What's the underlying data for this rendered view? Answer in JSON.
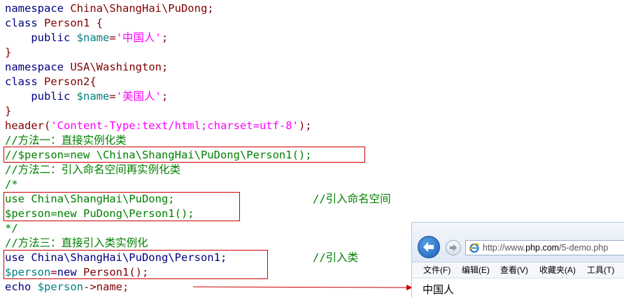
{
  "code": {
    "line1": {
      "kw": "namespace",
      "rest": " China\\ShangHai\\PuDong;"
    },
    "line2": {
      "kw": "class",
      "rest": " Person1 {"
    },
    "line3": {
      "indent": "    ",
      "kw": "public",
      "sp": " ",
      "var": "$name",
      "eq": "=",
      "str": "'中国人'",
      "end": ";"
    },
    "line4": {
      "text": "}"
    },
    "line5": {
      "kw": "namespace",
      "rest": " USA\\Washington;"
    },
    "line6": {
      "kw": "class",
      "rest": " Person2{"
    },
    "line7": {
      "indent": "    ",
      "kw": "public",
      "sp": " ",
      "var": "$name",
      "eq": "=",
      "str": "'美国人'",
      "end": ";"
    },
    "line8": {
      "text": "}"
    },
    "line9": {
      "fn": "header(",
      "str": "'Content-Type:text/html;charset=utf-8'",
      "end": ");"
    },
    "line10": {
      "text": "//方法一：直接实例化类"
    },
    "line11": {
      "text": "//$person=new \\China\\ShangHai\\PuDong\\Person1();"
    },
    "line12": {
      "text": "//方法二：引入命名空间再实例化类"
    },
    "line13": {
      "text": "/*"
    },
    "line14": {
      "code": "use China\\ShangHai\\PuDong;",
      "comment": "//引入命名空间"
    },
    "line15": {
      "text": "$person=new PuDong\\Person1();"
    },
    "line16": {
      "text": "*/"
    },
    "line17": {
      "text": "//方法三：直接引入类实例化"
    },
    "line18": {
      "code": "use China\\ShangHai\\PuDong\\Person1;",
      "comment": "//引入类"
    },
    "line19": {
      "var": "$person",
      "eq": "=",
      "kw": "new",
      "rest": " Person1();"
    },
    "line20": {
      "kw": "echo",
      "sp": " ",
      "var": "$person",
      "rest": "->name;"
    }
  },
  "browser": {
    "url_prefix": "http://www.",
    "url_domain": "php.com",
    "url_suffix": "/5-demo.php",
    "menu": [
      "文件(F)",
      "编辑(E)",
      "查看(V)",
      "收藏夹(A)",
      "工具(T)"
    ],
    "page_output": "中国人",
    "icons": {
      "back": "back-arrow-icon",
      "forward": "forward-arrow-icon",
      "ie": "ie-logo-icon"
    }
  },
  "colors": {
    "keyword": "#000080",
    "definition": "#800000",
    "variable": "#008080",
    "string": "#ff00ff",
    "comment": "#008000",
    "highlight_box": "#cc0000"
  }
}
